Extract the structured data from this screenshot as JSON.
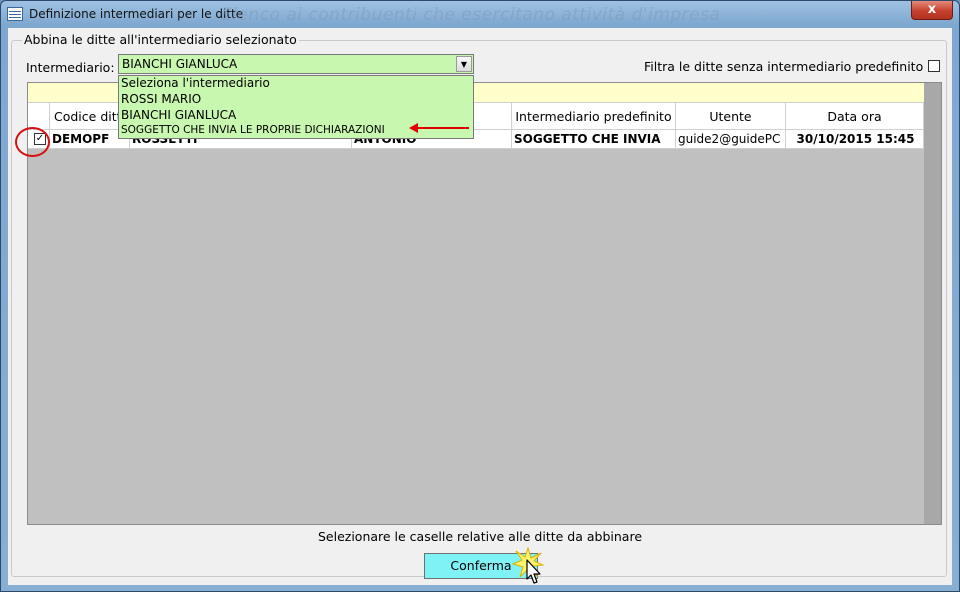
{
  "window": {
    "title": "Definizione intermediari per le ditte",
    "background_title": "Elenco ai contribuenti che esercitano attività d'impresa",
    "close_label": "x"
  },
  "group": {
    "legend": "Abbina le ditte all'intermediario selezionato"
  },
  "intermediario": {
    "label": "Intermediario:",
    "selected": "BIANCHI GIANLUCA",
    "options": [
      "Seleziona l'intermediario",
      "ROSSI MARIO",
      "BIANCHI GIANLUCA",
      "SOGGETTO CHE INVIA LE PROPRIE DICHIARAZIONI"
    ]
  },
  "filter": {
    "label": "Filtra le ditte senza intermediario predefinito",
    "checked": false
  },
  "table": {
    "columns": [
      "",
      "Codice ditta",
      "",
      "",
      "Intermediario predefinito",
      "Utente",
      "Data ora"
    ],
    "rows": [
      {
        "checked": true,
        "codice": "DEMOPF",
        "cognome": "ROSSETTI",
        "nome": "ANTONIO",
        "intermediario": "SOGGETTO CHE INVIA",
        "utente": "guide2@guidePC",
        "data_ora": "30/10/2015 15:45"
      }
    ]
  },
  "footer": {
    "message": "Selezionare le caselle relative alle ditte da abbinare",
    "confirm_label": "Conferma"
  },
  "colors": {
    "combo_background": "#c8f7b0",
    "confirm_background": "#7ff2f5",
    "annotation": "#e00000"
  }
}
